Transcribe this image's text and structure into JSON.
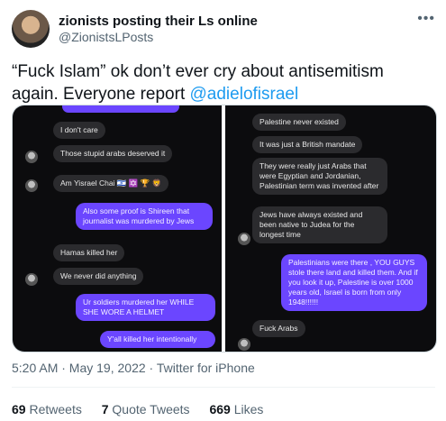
{
  "tweet": {
    "display_name": "zionists posting their Ls online",
    "handle": "@ZionistsLPosts",
    "more_icon": "•••",
    "text_line1": "“Fuck Islam” ok don’t ever cry about antisemitism",
    "text_line2_prefix": "again. Everyone report ",
    "mention": "@adielofisrael",
    "timestamp": "5:20 AM · May 19, 2022 · Twitter for iPhone",
    "retweets_count": "69",
    "retweets_label": "Retweets",
    "quote_count": "7",
    "quote_label": "Quote Tweets",
    "likes_count": "669",
    "likes_label": "Likes"
  },
  "left_chat": {
    "messages": [
      "I don't care",
      "Those stupid arabs deserved it",
      "Am Yisrael Chai 🇮🇱 ✡️ 🏆 🦁",
      "Also some proof is Shireen that journalist was murdered by Jews",
      "Hamas killed her",
      "We never did anything",
      "Ur soldiers murdered her WHILE SHE WORE A HELMET",
      "Y'all killed her intentionally"
    ]
  },
  "right_chat": {
    "messages": [
      "Palestine never existed",
      "It was just a British mandate",
      "They were really just Arabs that were Egyptian and Jordanian, Palestinian term was invented after",
      "Jews have always existed and been native to Judea for the longest time",
      "Palestinians were there , YOU GUYS stole there land and killed them. And if you look it up, Palestine is over 1000 years old, Israel is born from only 1948!!!!!!",
      "Fuck Arabs"
    ]
  },
  "colors": {
    "link": "#1d9bf0",
    "sent_bubble": "#6b46ff",
    "received_bubble": "#2b2b2e"
  }
}
